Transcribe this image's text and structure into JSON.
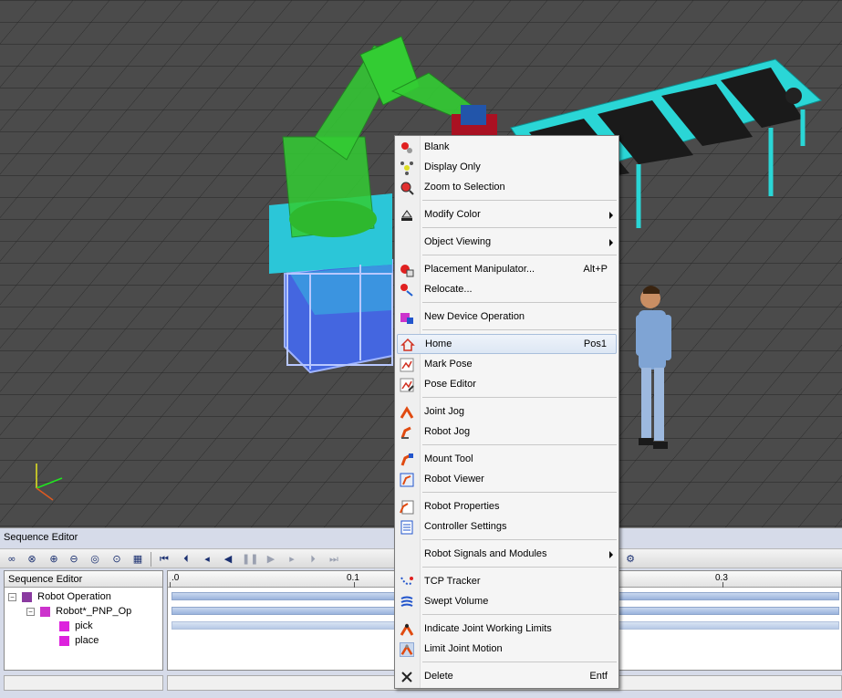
{
  "sequence_editor": {
    "panel_title": "Sequence Editor",
    "tree_header": "Sequence Editor",
    "tree": [
      {
        "label": "Robot Operation",
        "expander": "−"
      },
      {
        "label": "Robot*_PNP_Op",
        "expander": "−"
      },
      {
        "label": "pick"
      },
      {
        "label": "place"
      }
    ],
    "ruler_ticks": [
      ".0",
      "0.1",
      "0.3"
    ],
    "toolbar_icons": [
      "link-icon",
      "unlink-icon",
      "zoom-in-icon",
      "zoom-out-icon",
      "zoom-fit-icon",
      "zoom-selection-icon",
      "grid-icon",
      "jump-start-icon",
      "step-back-icon",
      "prev-frame-icon",
      "play-backward-icon",
      "pause-icon",
      "play-forward-icon",
      "next-frame-icon",
      "step-forward-icon",
      "jump-end-icon",
      "settings-icon"
    ]
  },
  "context_menu": {
    "items": [
      {
        "label": "Blank",
        "icon": "blank-icon"
      },
      {
        "label": "Display Only",
        "icon": "display-only-icon"
      },
      {
        "label": "Zoom to Selection",
        "icon": "zoom-to-selection-icon"
      },
      {
        "label": "Modify Color",
        "icon": "modify-color-icon",
        "submenu": true
      },
      {
        "label": "Object Viewing",
        "icon": "",
        "submenu": true
      },
      {
        "label": "Placement Manipulator...",
        "icon": "placement-manipulator-icon",
        "shortcut": "Alt+P"
      },
      {
        "label": "Relocate...",
        "icon": "relocate-icon"
      },
      {
        "label": "New Device Operation",
        "icon": "new-device-operation-icon"
      },
      {
        "label": "Home",
        "icon": "home-icon",
        "shortcut": "Pos1",
        "highlighted": true
      },
      {
        "label": "Mark Pose",
        "icon": "mark-pose-icon"
      },
      {
        "label": "Pose Editor",
        "icon": "pose-editor-icon"
      },
      {
        "label": "Joint Jog",
        "icon": "joint-jog-icon"
      },
      {
        "label": "Robot Jog",
        "icon": "robot-jog-icon"
      },
      {
        "label": "Mount Tool",
        "icon": "mount-tool-icon"
      },
      {
        "label": "Robot Viewer",
        "icon": "robot-viewer-icon"
      },
      {
        "label": "Robot Properties",
        "icon": "robot-properties-icon"
      },
      {
        "label": "Controller Settings",
        "icon": "controller-settings-icon"
      },
      {
        "label": "Robot Signals and Modules",
        "icon": "",
        "submenu": true
      },
      {
        "label": "TCP Tracker",
        "icon": "tcp-tracker-icon"
      },
      {
        "label": "Swept Volume",
        "icon": "swept-volume-icon"
      },
      {
        "label": "Indicate Joint Working Limits",
        "icon": "joint-limits-icon"
      },
      {
        "label": "Limit Joint Motion",
        "icon": "limit-joint-motion-icon",
        "pressed": true
      },
      {
        "label": "Delete",
        "icon": "delete-icon",
        "shortcut": "Entf"
      }
    ]
  },
  "colors": {
    "robot": "#33cc33",
    "conveyor": "#2ad6d6",
    "base": "#4466e0",
    "floor": "#4a4a4a",
    "menu_highlight": "#dde7f4"
  }
}
